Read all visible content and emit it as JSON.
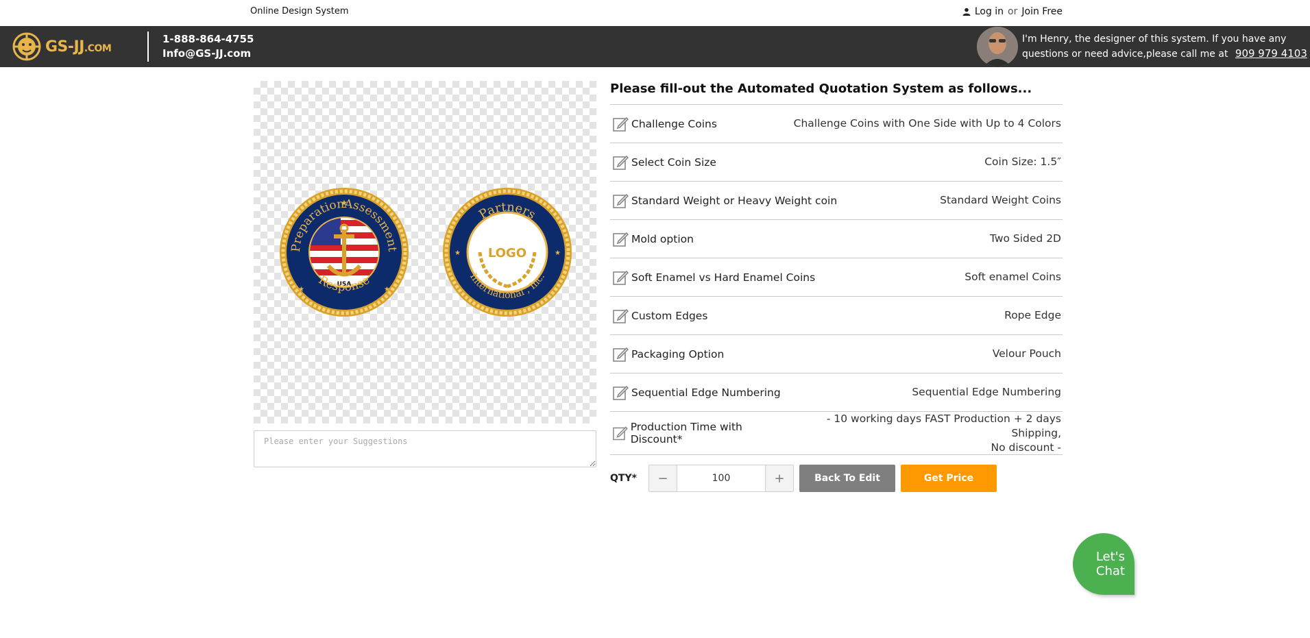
{
  "topbar": {
    "title": "Online Design System",
    "login_label": "Log in",
    "or_text": "or",
    "join_label": "Join Free"
  },
  "header": {
    "logo_text": "GS-JJ",
    "logo_suffix": ".COM",
    "phone": "1-888-864-4755",
    "email": "Info@GS-JJ.com",
    "henry_text": "I'm Henry, the designer of this system. If you have any questions or need advice,please call me at",
    "henry_phone": "909 979 4103"
  },
  "coins": {
    "front_top_left": "Preparation",
    "front_top_right": "Assessment",
    "front_bottom": "Response",
    "front_center": "USA",
    "back_top": "Partners",
    "back_bottom": "International , Inc.",
    "back_center": "LOGO"
  },
  "suggestions": {
    "placeholder": "Please enter your Suggestions"
  },
  "form": {
    "title": "Please fill-out the Automated Quotation System as follows...",
    "rows": [
      {
        "label": "Challenge Coins",
        "value": "Challenge Coins with One Side with Up to 4 Colors"
      },
      {
        "label": "Select Coin Size",
        "value": "Coin Size: 1.5″"
      },
      {
        "label": "Standard Weight or Heavy Weight coin",
        "value": "Standard Weight Coins"
      },
      {
        "label": "Mold option",
        "value": "Two Sided 2D"
      },
      {
        "label": "Soft Enamel vs Hard Enamel Coins",
        "value": "Soft enamel Coins"
      },
      {
        "label": "Custom Edges",
        "value": "Rope Edge"
      },
      {
        "label": "Packaging Option",
        "value": "Velour Pouch"
      },
      {
        "label": "Sequential Edge Numbering",
        "value": "Sequential Edge Numbering"
      },
      {
        "label": "Production Time with Discount*",
        "value_line1": "- 10 working days FAST Production + 2 days Shipping,",
        "value_line2": "No discount -"
      }
    ]
  },
  "qty": {
    "label": "QTY*",
    "value": "100",
    "minus": "−",
    "plus": "+"
  },
  "buttons": {
    "back": "Back To Edit",
    "price": "Get Price"
  },
  "chat": {
    "line1": "Let's",
    "line2": "Chat"
  },
  "colors": {
    "header_bg": "#333333",
    "accent_orange": "#ff9900",
    "chat_green": "#4caf50",
    "gold": "#e8b54a",
    "navy": "#0d2a6b"
  }
}
